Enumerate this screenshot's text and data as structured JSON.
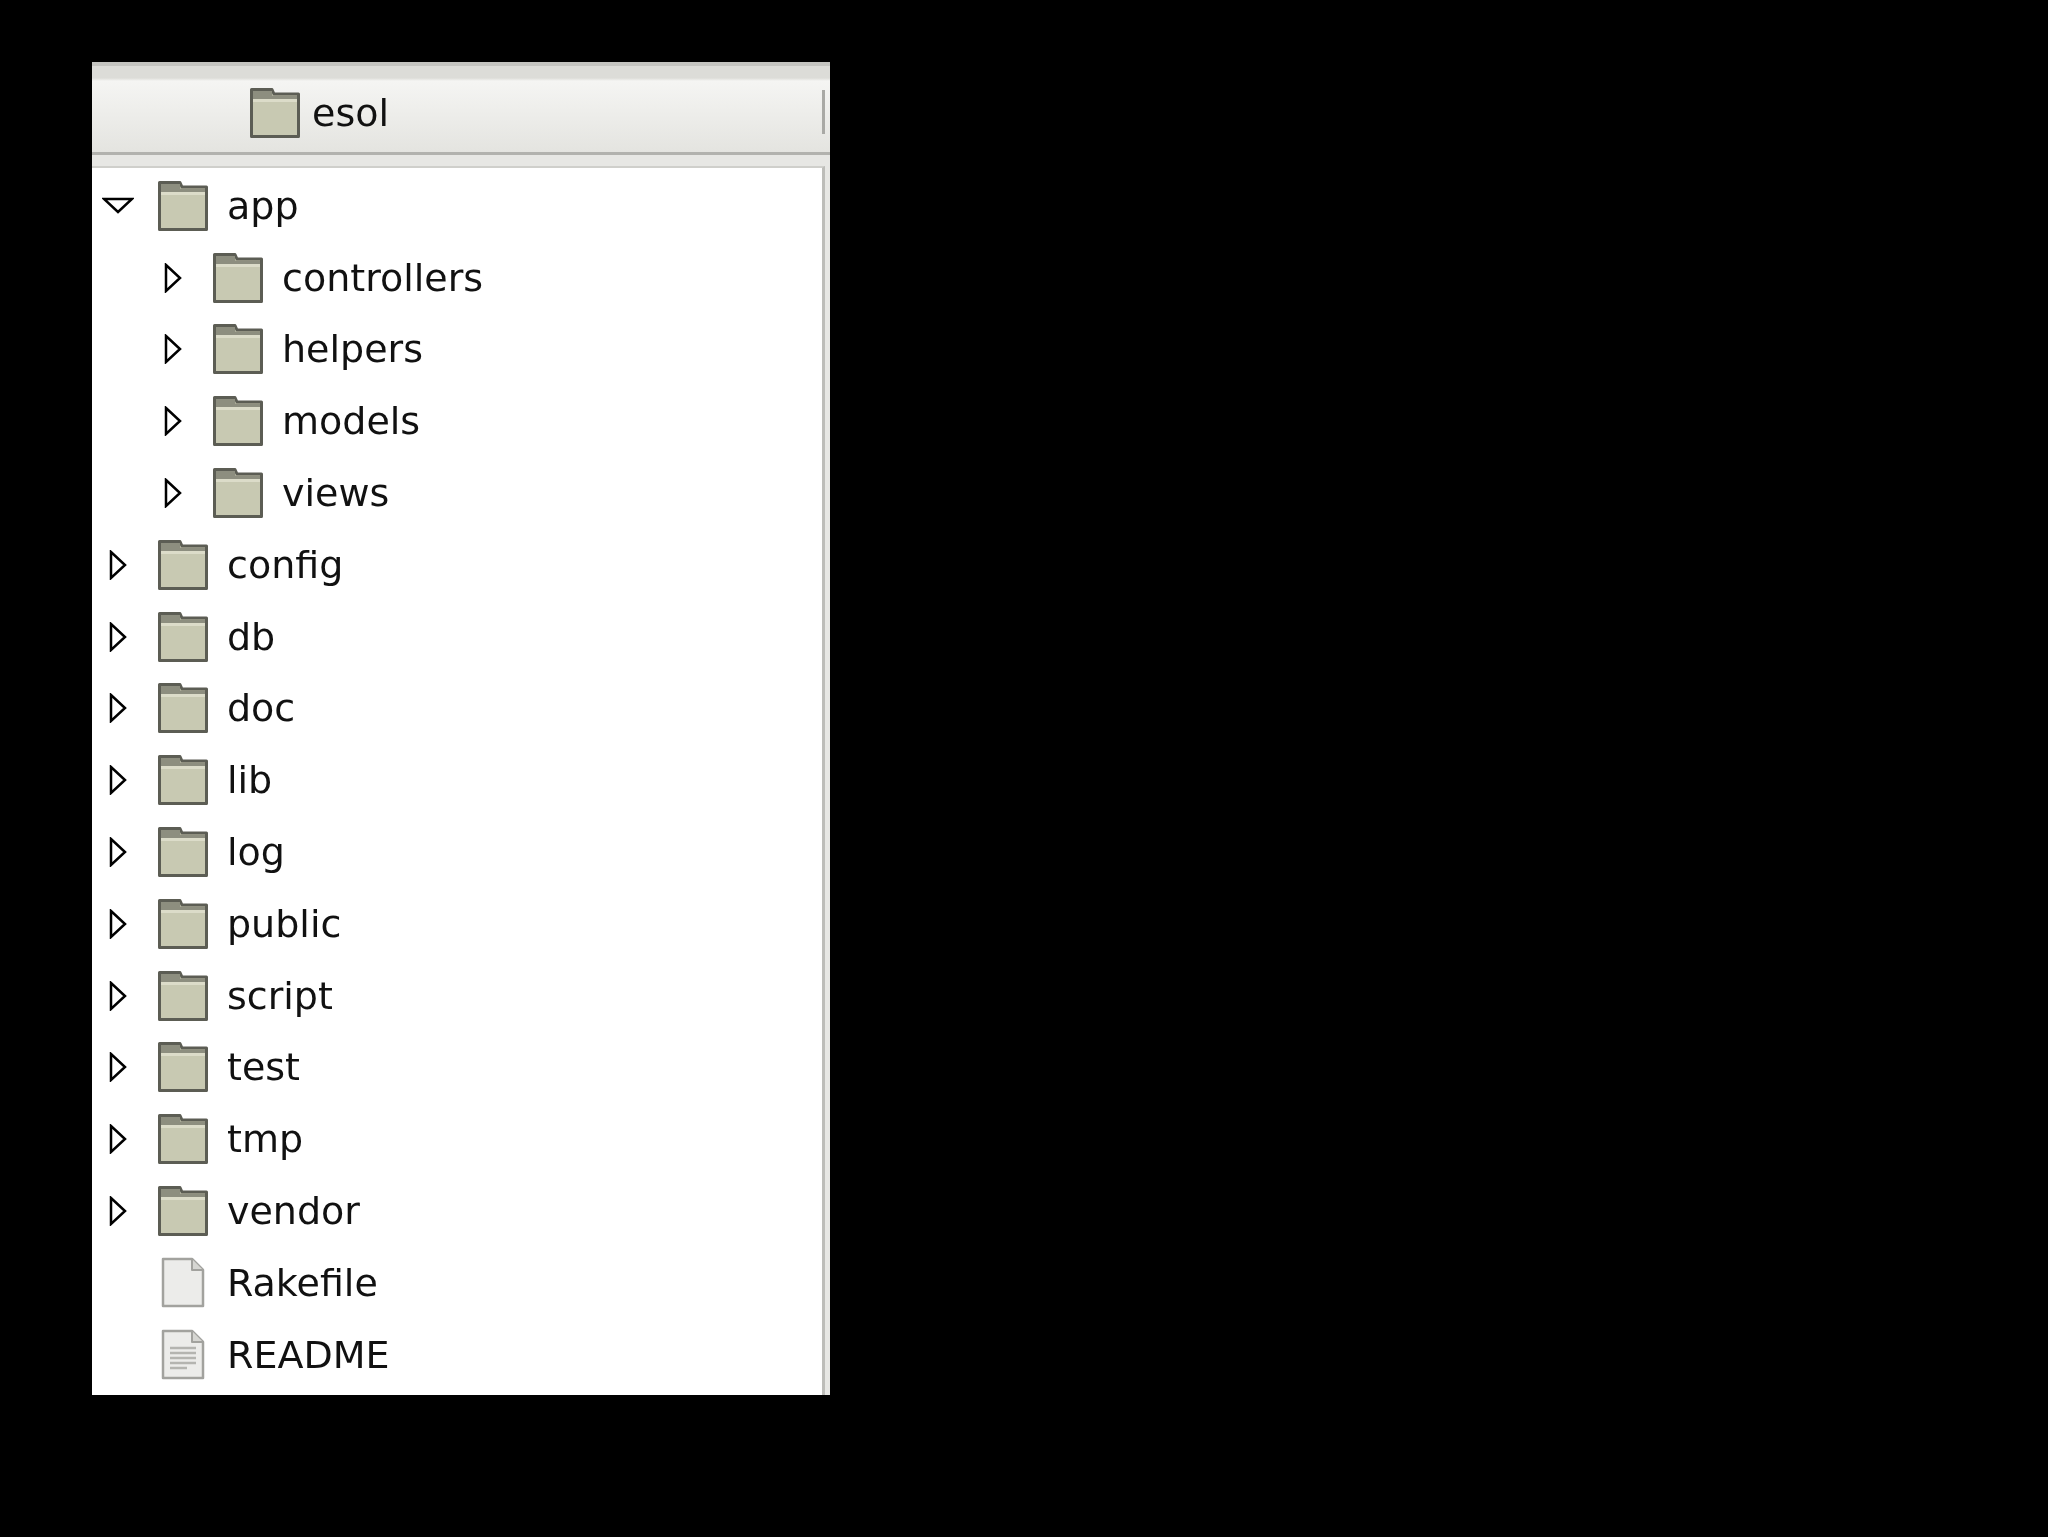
{
  "header": {
    "title": "esol"
  },
  "tree": [
    {
      "kind": "folder",
      "name": "app",
      "expanded": true,
      "children": [
        {
          "kind": "folder",
          "name": "controllers",
          "expanded": false
        },
        {
          "kind": "folder",
          "name": "helpers",
          "expanded": false
        },
        {
          "kind": "folder",
          "name": "models",
          "expanded": false
        },
        {
          "kind": "folder",
          "name": "views",
          "expanded": false
        }
      ]
    },
    {
      "kind": "folder",
      "name": "config",
      "expanded": false
    },
    {
      "kind": "folder",
      "name": "db",
      "expanded": false
    },
    {
      "kind": "folder",
      "name": "doc",
      "expanded": false
    },
    {
      "kind": "folder",
      "name": "lib",
      "expanded": false
    },
    {
      "kind": "folder",
      "name": "log",
      "expanded": false
    },
    {
      "kind": "folder",
      "name": "public",
      "expanded": false
    },
    {
      "kind": "folder",
      "name": "script",
      "expanded": false
    },
    {
      "kind": "folder",
      "name": "test",
      "expanded": false
    },
    {
      "kind": "folder",
      "name": "tmp",
      "expanded": false
    },
    {
      "kind": "folder",
      "name": "vendor",
      "expanded": false
    },
    {
      "kind": "file",
      "name": "Rakefile"
    },
    {
      "kind": "text",
      "name": "README"
    }
  ]
}
